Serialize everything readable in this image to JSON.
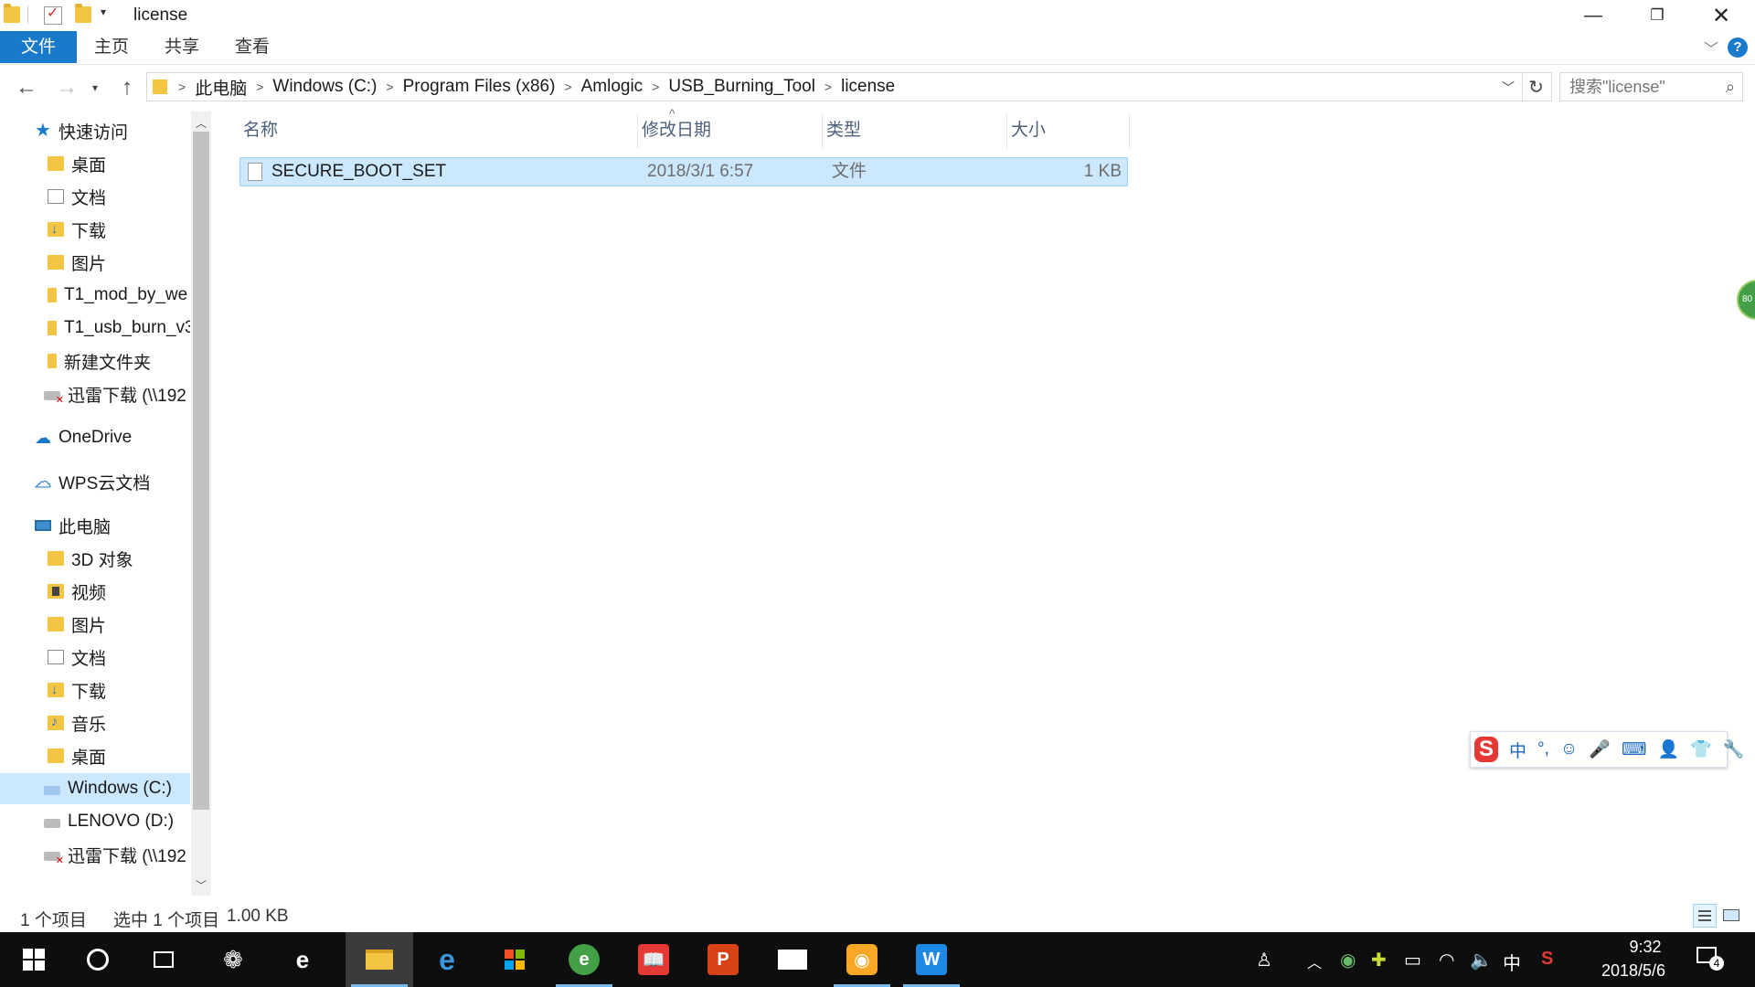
{
  "window": {
    "title": "license"
  },
  "ribbon": {
    "tabs": [
      {
        "label": "文件",
        "active": true
      },
      {
        "label": "主页"
      },
      {
        "label": "共享"
      },
      {
        "label": "查看"
      }
    ],
    "help": "?"
  },
  "address": {
    "crumbs": [
      "此电脑",
      "Windows (C:)",
      "Program Files (x86)",
      "Amlogic",
      "USB_Burning_Tool",
      "license"
    ]
  },
  "search": {
    "placeholder": "搜索\"license\""
  },
  "nav": {
    "items": [
      {
        "label": "快速访问",
        "icon": "star-icon"
      },
      {
        "label": "桌面",
        "icon": "desktop-folder-icon",
        "pinned": true
      },
      {
        "label": "文档",
        "icon": "documents-folder-icon",
        "pinned": true
      },
      {
        "label": "下载",
        "icon": "downloads-folder-icon",
        "pinned": true
      },
      {
        "label": "图片",
        "icon": "pictures-folder-icon",
        "pinned": true
      },
      {
        "label": "T1_mod_by_we",
        "icon": "folder-icon"
      },
      {
        "label": "T1_usb_burn_v3",
        "icon": "folder-icon"
      },
      {
        "label": "新建文件夹",
        "icon": "folder-icon"
      },
      {
        "label": "迅雷下载 (\\\\192",
        "icon": "network-drive-disconnected-icon"
      },
      {
        "label": "OneDrive",
        "icon": "onedrive-cloud-icon"
      },
      {
        "label": "WPS云文档",
        "icon": "wps-cloud-icon"
      },
      {
        "label": "此电脑",
        "icon": "this-pc-icon"
      },
      {
        "label": "3D 对象",
        "icon": "3d-objects-folder-icon"
      },
      {
        "label": "视频",
        "icon": "videos-folder-icon"
      },
      {
        "label": "图片",
        "icon": "pictures-folder-icon"
      },
      {
        "label": "文档",
        "icon": "documents-folder-icon"
      },
      {
        "label": "下载",
        "icon": "downloads-folder-icon"
      },
      {
        "label": "音乐",
        "icon": "music-folder-icon"
      },
      {
        "label": "桌面",
        "icon": "desktop-folder-icon"
      },
      {
        "label": "Windows (C:)",
        "icon": "windows-drive-icon",
        "selected": true
      },
      {
        "label": "LENOVO (D:)",
        "icon": "drive-icon"
      },
      {
        "label": "迅雷下载 (\\\\192",
        "icon": "network-drive-disconnected-icon"
      }
    ]
  },
  "files": {
    "columns": [
      "名称",
      "修改日期",
      "类型",
      "大小"
    ],
    "rows": [
      {
        "name": "SECURE_BOOT_SET",
        "modified": "2018/3/1 6:57",
        "type": "文件",
        "size": "1 KB",
        "selected": true
      }
    ]
  },
  "status": {
    "count": "1 个项目",
    "selection": "选中 1 个项目",
    "size": "1.00 KB"
  },
  "ime": {
    "mode": "中"
  },
  "side_badge": "80",
  "taskbar": {
    "clock_time": "9:32",
    "clock_date": "2018/5/6",
    "ime_indicator": "中",
    "notifications": "4"
  },
  "colors": {
    "accent": "#1979ca",
    "selection": "#cce8ff",
    "taskbar": "#0e0e0e"
  }
}
